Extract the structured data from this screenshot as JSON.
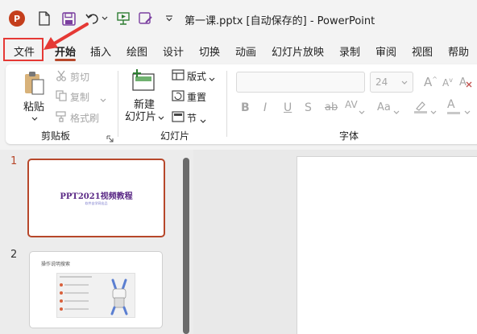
{
  "window": {
    "title": "第一课.pptx [自动保存的]  -  PowerPoint",
    "app_icon_letter": "P"
  },
  "tabs": [
    {
      "label": "文件"
    },
    {
      "label": "开始"
    },
    {
      "label": "插入"
    },
    {
      "label": "绘图"
    },
    {
      "label": "设计"
    },
    {
      "label": "切换"
    },
    {
      "label": "动画"
    },
    {
      "label": "幻灯片放映"
    },
    {
      "label": "录制"
    },
    {
      "label": "审阅"
    },
    {
      "label": "视图"
    },
    {
      "label": "帮助"
    }
  ],
  "ribbon": {
    "clipboard": {
      "paste": "粘贴",
      "cut": "剪切",
      "copy": "复制",
      "format_painter": "格式刷",
      "group_label": "剪贴板"
    },
    "slides": {
      "new_slide_line1": "新建",
      "new_slide_line2": "幻灯片",
      "layout": "版式",
      "reset": "重置",
      "section": "节",
      "group_label": "幻灯片"
    },
    "font": {
      "font_size": "24",
      "bold": "B",
      "italic": "I",
      "underline": "U",
      "strike": "S",
      "spacing": "AV",
      "case": "Aa",
      "color_a": "A",
      "group_label": "字体"
    }
  },
  "slides_panel": {
    "slides": [
      {
        "number": "1",
        "title": "PPT2021视频教程",
        "subtitle": "软件自学网出品"
      },
      {
        "number": "2",
        "title": "操作说明搜索"
      }
    ]
  },
  "colors": {
    "accent": "#b7472a",
    "highlight": "#e53935",
    "slide1_title": "#5b2a86"
  }
}
